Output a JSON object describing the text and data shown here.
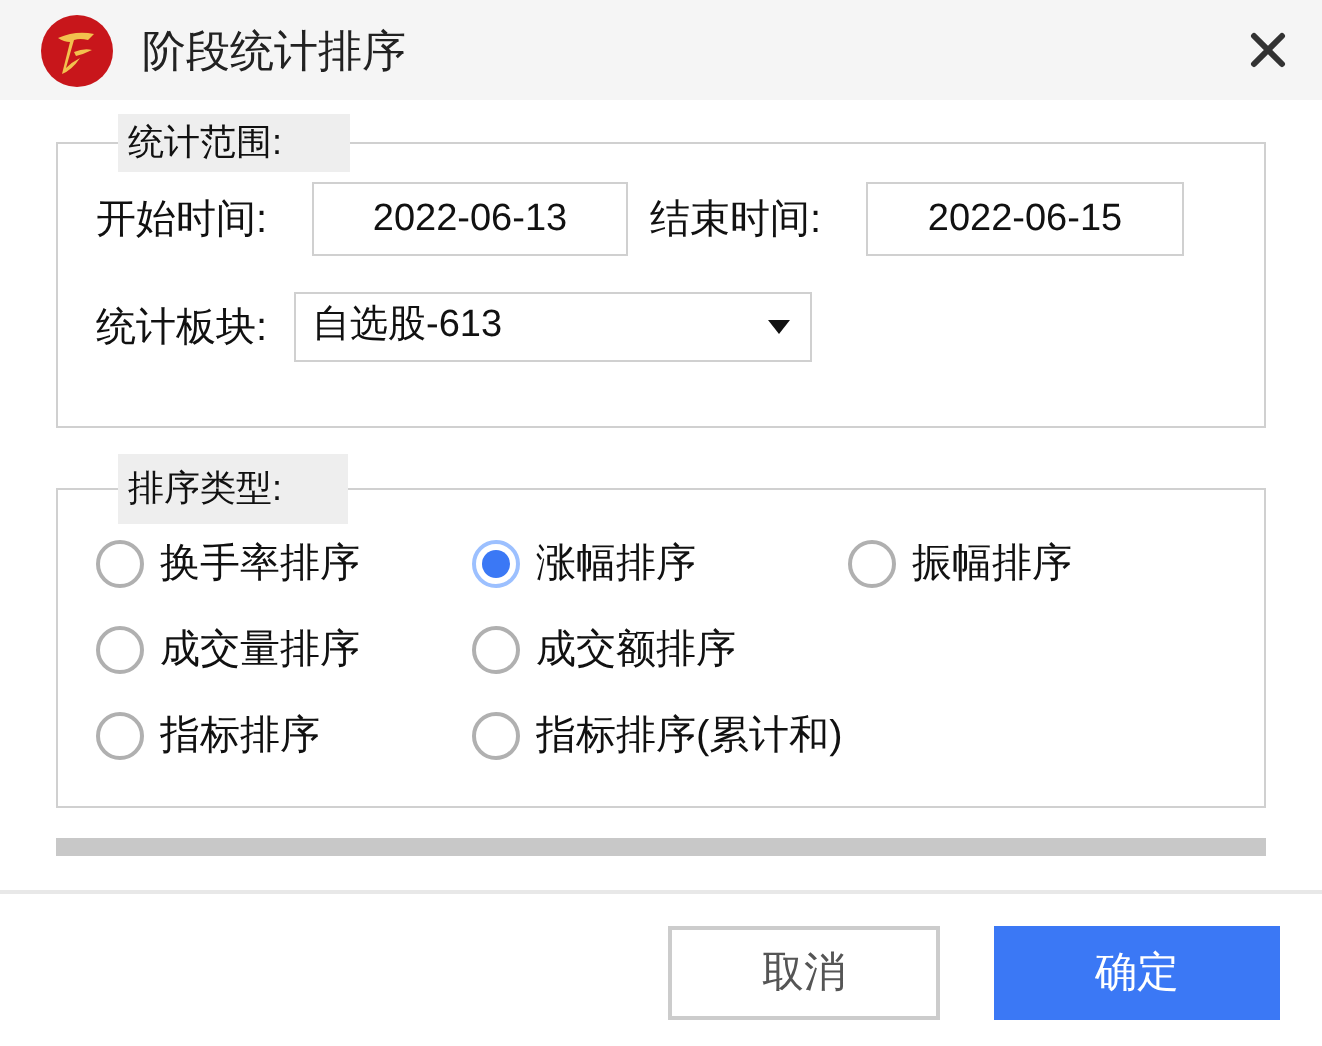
{
  "window": {
    "title": "阶段统计排序"
  },
  "range_group": {
    "legend": "统计范围:",
    "start_label": "开始时间:",
    "start_value": "2022-06-13",
    "end_label": "结束时间:",
    "end_value": "2022-06-15",
    "sector_label": "统计板块:",
    "sector_value": "自选股-613"
  },
  "sort_group": {
    "legend": "排序类型:",
    "rows": [
      [
        {
          "label": "换手率排序",
          "selected": false
        },
        {
          "label": "涨幅排序",
          "selected": true
        },
        {
          "label": "振幅排序",
          "selected": false
        }
      ],
      [
        {
          "label": "成交量排序",
          "selected": false
        },
        {
          "label": "成交额排序",
          "selected": false
        }
      ],
      [
        {
          "label": "指标排序",
          "selected": false
        },
        {
          "label": "指标排序(累计和)",
          "selected": false
        }
      ]
    ]
  },
  "buttons": [
    {
      "label": "取消",
      "kind": "secondary"
    },
    {
      "label": "确定",
      "kind": "primary"
    }
  ]
}
